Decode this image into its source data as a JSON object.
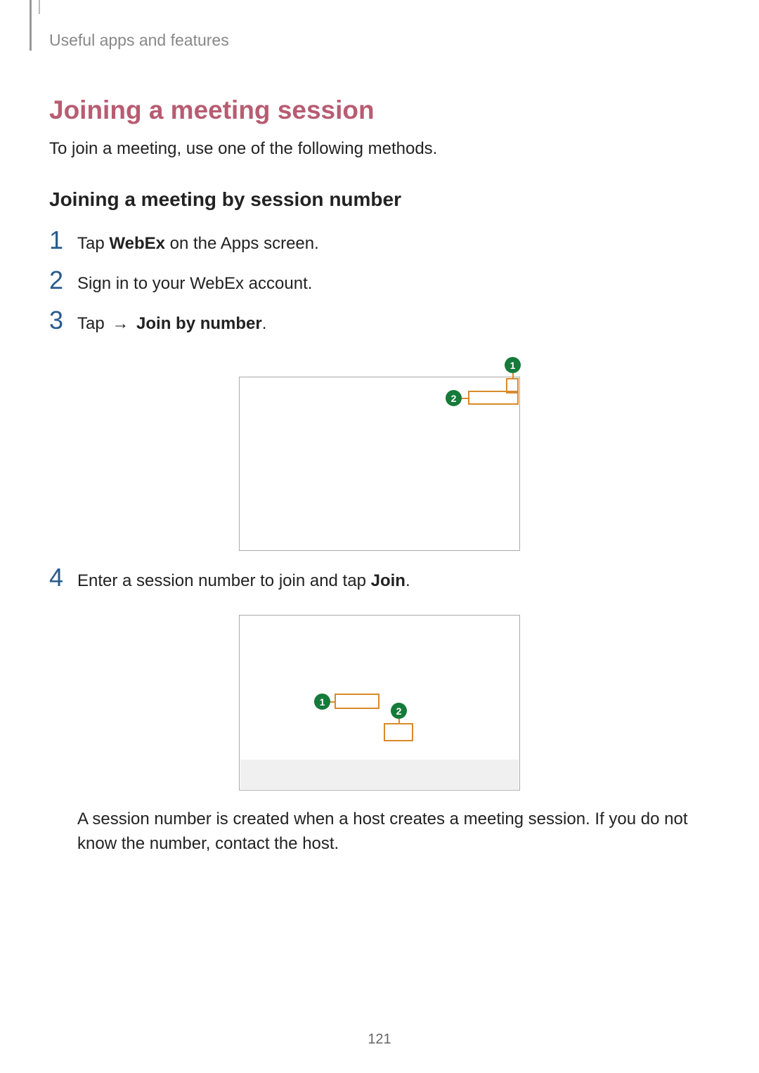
{
  "header": {
    "breadcrumb": "Useful apps and features"
  },
  "section": {
    "title": "Joining a meeting session",
    "intro": "To join a meeting, use one of the following methods.",
    "subtitle": "Joining a meeting by session number"
  },
  "steps": {
    "s1": {
      "num": "1",
      "pre": "Tap ",
      "bold": "WebEx",
      "post": " on the Apps screen."
    },
    "s2": {
      "num": "2",
      "text": "Sign in to your WebEx account."
    },
    "s3": {
      "num": "3",
      "pre": "Tap ",
      "arrow": "→",
      "bold": "Join by number",
      "post": "."
    },
    "s4": {
      "num": "4",
      "pre": "Enter a session number to join and tap ",
      "bold": "Join",
      "post": "."
    }
  },
  "callouts": {
    "c1": "1",
    "c2": "2"
  },
  "note": "A session number is created when a host creates a meeting session. If you do not know the number, contact the host.",
  "page_number": "121"
}
